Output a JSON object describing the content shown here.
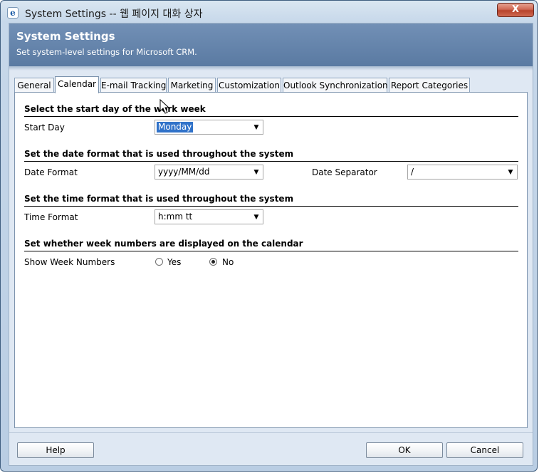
{
  "window": {
    "title": "System Settings -- 웹 페이지 대화 상자",
    "close_glyph": "X"
  },
  "header": {
    "title": "System Settings",
    "subtitle": "Set system-level settings for Microsoft CRM."
  },
  "tabs": [
    {
      "label": "General"
    },
    {
      "label": "Calendar"
    },
    {
      "label": "E-mail Tracking"
    },
    {
      "label": "Marketing"
    },
    {
      "label": "Customization"
    },
    {
      "label": "Outlook Synchronization"
    },
    {
      "label": "Report Categories"
    }
  ],
  "active_tab": "Calendar",
  "sections": {
    "start_day": {
      "title": "Select the start day of the work week",
      "field_label": "Start Day",
      "value": "Monday"
    },
    "date_format": {
      "title": "Set the date format that is used throughout the system",
      "field_label": "Date Format",
      "value": "yyyy/MM/dd",
      "separator_label": "Date Separator",
      "separator_value": "/"
    },
    "time_format": {
      "title": "Set the time format that is used throughout the system",
      "field_label": "Time Format",
      "value": "h:mm tt"
    },
    "week_numbers": {
      "title": "Set whether week numbers are displayed on the calendar",
      "field_label": "Show Week Numbers",
      "option_yes": "Yes",
      "option_no": "No",
      "selected": "No"
    }
  },
  "buttons": {
    "help": "Help",
    "ok": "OK",
    "cancel": "Cancel"
  },
  "icons": {
    "app": "ie-icon",
    "dropdown": "chevron-down-icon",
    "cursor": "mouse-pointer-icon"
  }
}
